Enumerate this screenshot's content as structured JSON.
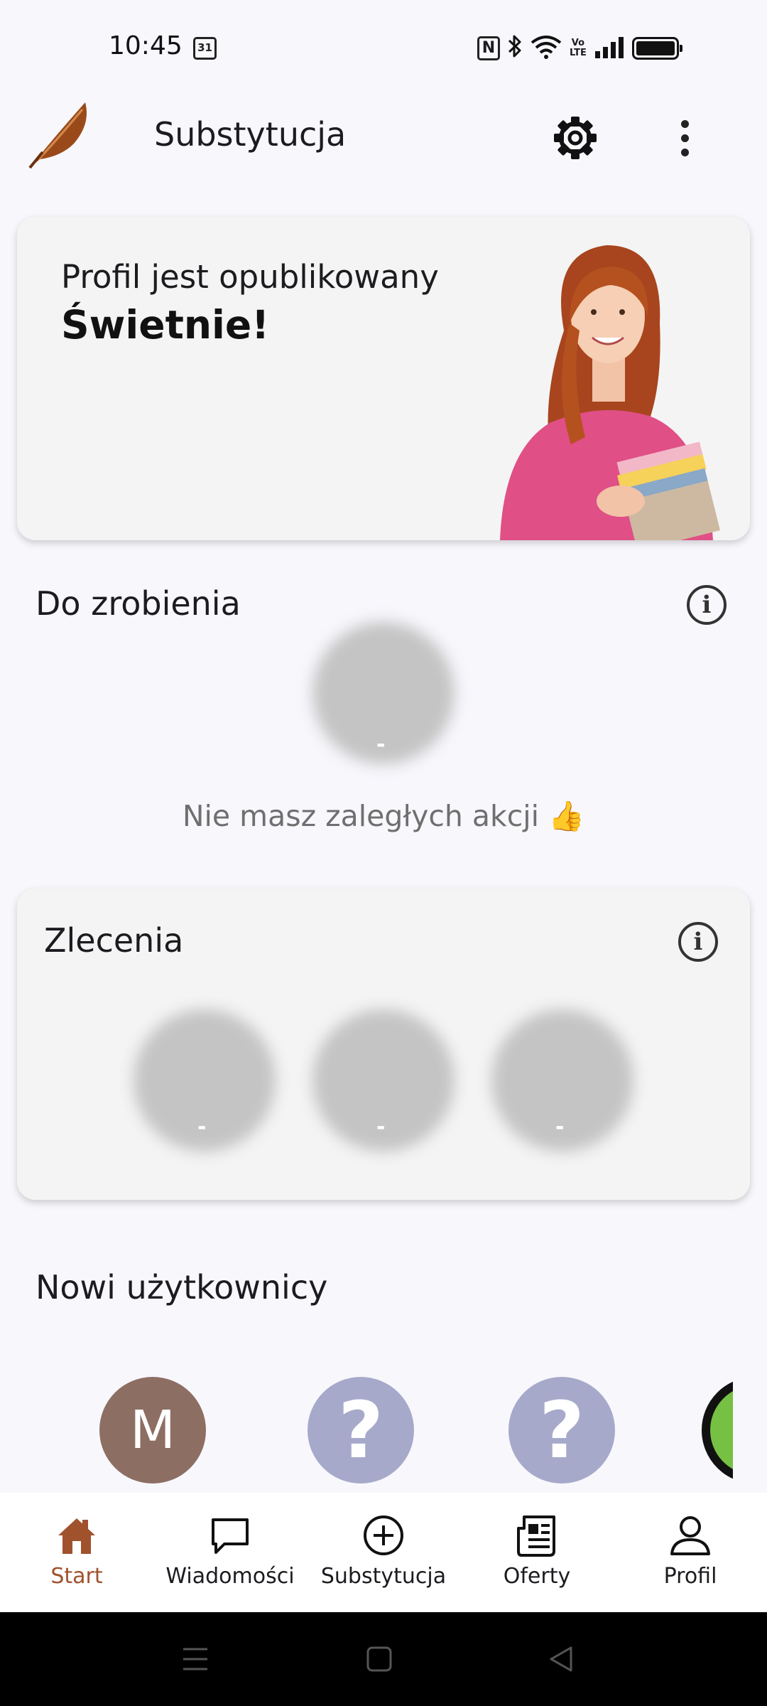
{
  "status_bar": {
    "time": "10:45",
    "calendar_day": "31",
    "nfc_label": "N",
    "volte_label": "Vo\nLTE"
  },
  "app_bar": {
    "title": "Substytucja",
    "logo_icon": "feather-logo",
    "settings_icon": "gear-icon",
    "more_icon": "more-vert-icon"
  },
  "profile_card": {
    "subtitle": "Profil jest opublikowany",
    "headline": "Świetnie!",
    "image": "woman-with-books"
  },
  "todo": {
    "title": "Do zrobienia",
    "stat_value": "-",
    "empty_message": "Nie masz zaległych akcji 👍"
  },
  "orders": {
    "title": "Zlecenia",
    "stats": [
      "-",
      "-",
      "-"
    ]
  },
  "new_users": {
    "title": "Nowi użytkownicy",
    "avatars": [
      "M",
      "?",
      "?"
    ]
  },
  "bottom_nav": {
    "items": [
      {
        "label": "Start",
        "icon": "home-icon",
        "active": true
      },
      {
        "label": "Wiadomości",
        "icon": "chat-icon",
        "active": false
      },
      {
        "label": "Substytucja",
        "icon": "add-circle-icon",
        "active": false
      },
      {
        "label": "Oferty",
        "icon": "newspaper-icon",
        "active": false
      },
      {
        "label": "Profil",
        "icon": "person-icon",
        "active": false
      }
    ]
  },
  "colors": {
    "accent": "#a0522d",
    "background": "#f8f7fc",
    "card": "#f4f4f4",
    "avatar_m": "#8d6e63",
    "avatar_unknown": "#a7a9cb"
  }
}
